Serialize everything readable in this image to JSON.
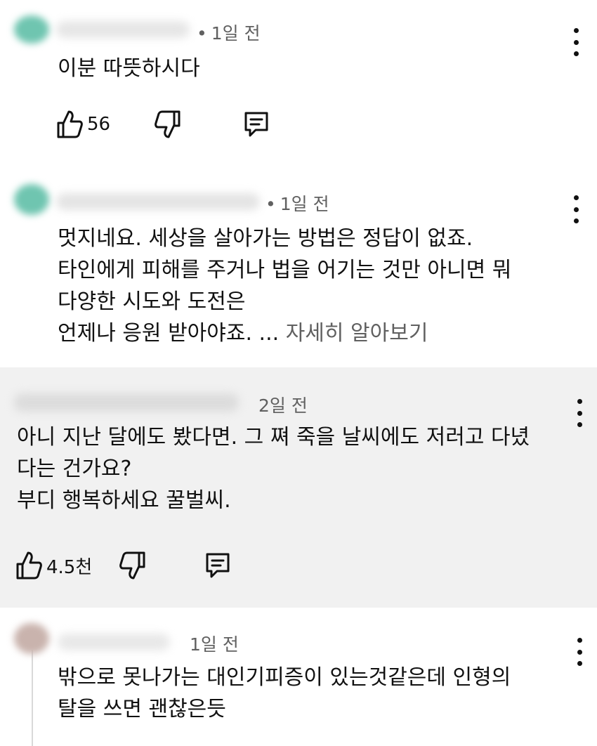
{
  "comments": [
    {
      "time": "1일 전",
      "lines": [
        "이분 따뜻하시다"
      ],
      "likes": "56",
      "colors": {
        "avatar": "#6fc5b0",
        "namebar": "#e6e6e6"
      }
    },
    {
      "time": "1일 전",
      "lines": [
        "멋지네요. 세상을 살아가는 방법은 정답이 없죠.",
        "타인에게 피해를 주거나 법을 어기는 것만 아니면 뭐",
        "다양한 시도와 도전은",
        "언제나 응원 받아야죠. ..."
      ],
      "more_link": "자세히 알아보기",
      "colors": {
        "avatar": "#6fc5b0",
        "namebar": "#e4e4e4"
      }
    },
    {
      "time": "2일 전",
      "lines": [
        "아니 지난 달에도 봤다면. 그 쪄 죽을 날씨에도 저러고 다녔",
        "다는 건가요?",
        "부디 행복하세요 꿀벌씨."
      ],
      "likes": "4.5천",
      "colors": {
        "namebar": "#dcdcdc"
      }
    },
    {
      "time": "1일 전",
      "lines": [
        "밖으로 못나가는 대인기피증이 있는것같은데 인형의",
        "탈을 쓰면 괜찮은듯"
      ],
      "colors": {
        "avatar": "#c9b3ad",
        "namebar": "#e8e8e8"
      }
    }
  ],
  "icons": {
    "like": "thumbs-up-icon",
    "dislike": "thumbs-down-icon",
    "reply": "reply-comment-icon",
    "more": "more-vertical-icon"
  }
}
